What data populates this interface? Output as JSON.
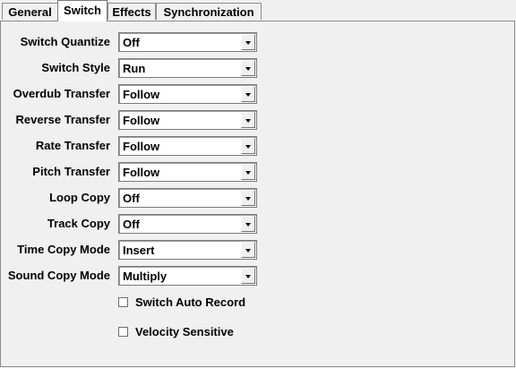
{
  "tabs": [
    {
      "label": "General"
    },
    {
      "label": "Switch",
      "active": true
    },
    {
      "label": "Effects"
    },
    {
      "label": "Synchronization"
    }
  ],
  "fields": [
    {
      "label": "Switch Quantize",
      "value": "Off"
    },
    {
      "label": "Switch Style",
      "value": "Run"
    },
    {
      "label": "Overdub Transfer",
      "value": "Follow"
    },
    {
      "label": "Reverse Transfer",
      "value": "Follow"
    },
    {
      "label": "Rate Transfer",
      "value": "Follow"
    },
    {
      "label": "Pitch Transfer",
      "value": "Follow"
    },
    {
      "label": "Loop Copy",
      "value": "Off"
    },
    {
      "label": "Track Copy",
      "value": "Off"
    },
    {
      "label": "Time Copy Mode",
      "value": "Insert"
    },
    {
      "label": "Sound Copy Mode",
      "value": "Multiply"
    }
  ],
  "checkboxes": [
    {
      "label": "Switch Auto Record",
      "checked": false
    },
    {
      "label": "Velocity Sensitive",
      "checked": false
    }
  ]
}
